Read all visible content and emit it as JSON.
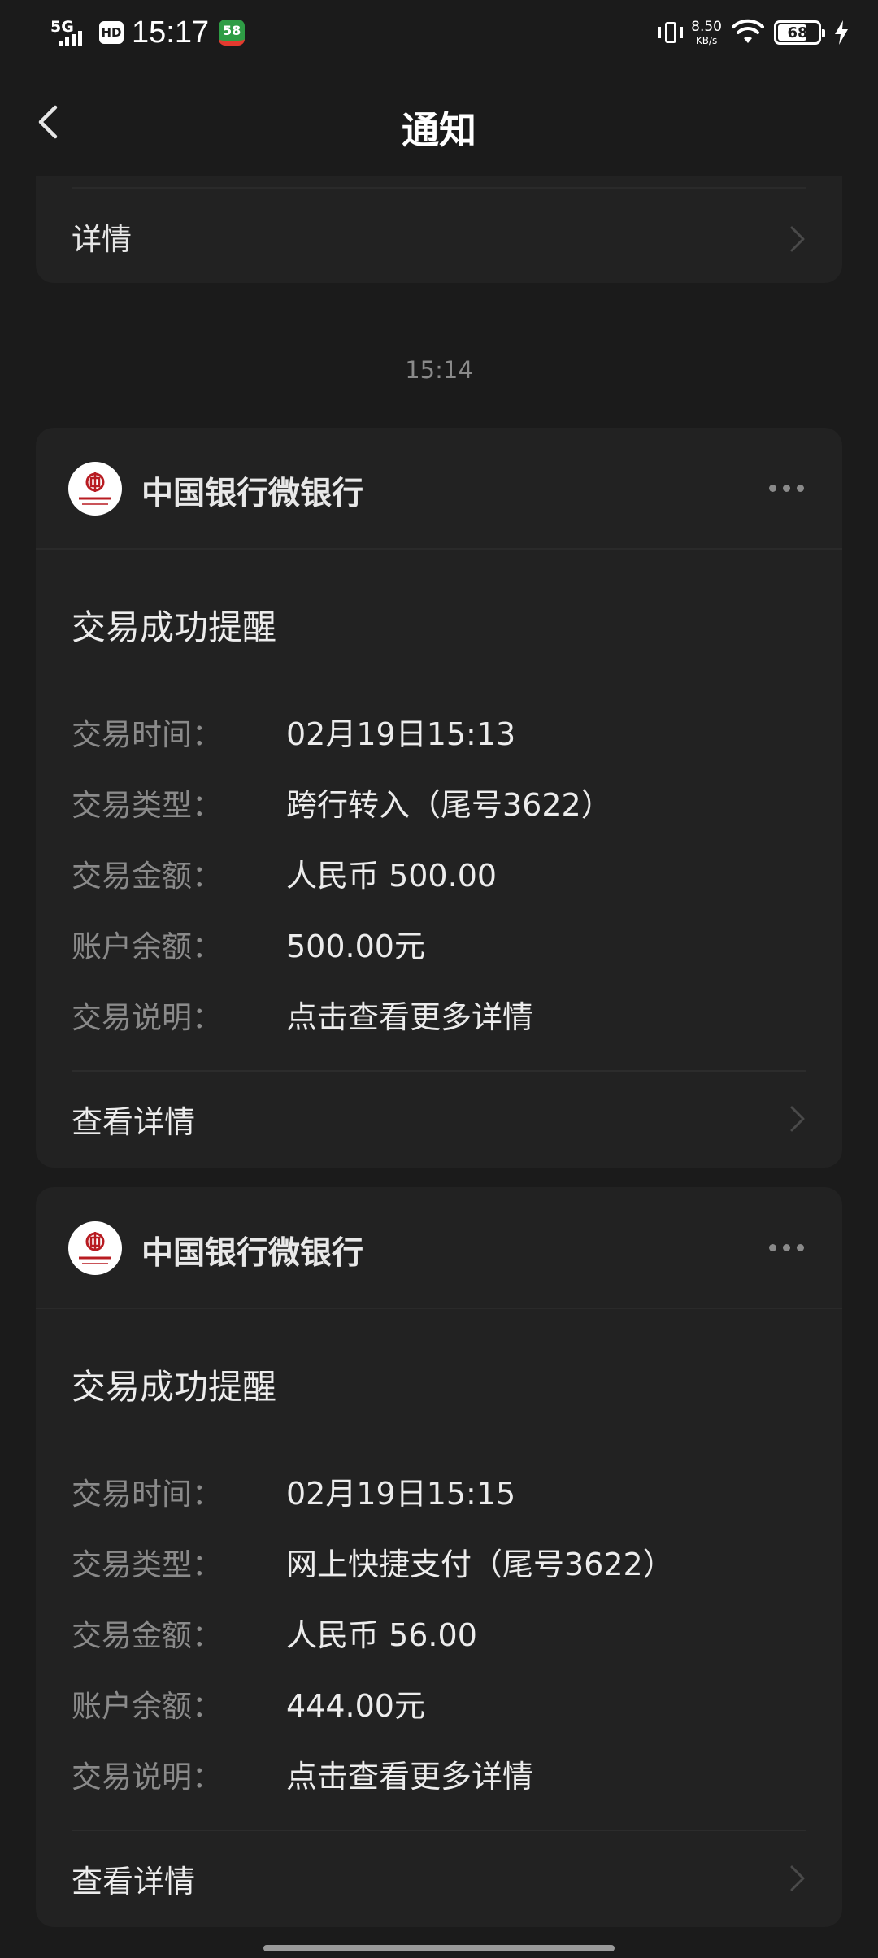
{
  "status_bar": {
    "network": "5G",
    "hd": "HD",
    "time": "15:17",
    "app_badge": "58",
    "net_speed_value": "8.50",
    "net_speed_unit": "KB/s",
    "battery_level": "68"
  },
  "header": {
    "title": "通知"
  },
  "prev_card": {
    "detail_label": "详情"
  },
  "timestamp": "15:14",
  "messages": [
    {
      "sender": "中国银行微银行",
      "title": "交易成功提醒",
      "fields": [
        {
          "label": "交易时间：",
          "value": "02月19日15:13"
        },
        {
          "label": "交易类型：",
          "value": "跨行转入（尾号3622）"
        },
        {
          "label": "交易金额：",
          "value": "人民币 500.00"
        },
        {
          "label": "账户余额：",
          "value": "500.00元"
        },
        {
          "label": "交易说明：",
          "value": "点击查看更多详情"
        }
      ],
      "footer_label": "查看详情"
    },
    {
      "sender": "中国银行微银行",
      "title": "交易成功提醒",
      "fields": [
        {
          "label": "交易时间：",
          "value": "02月19日15:15"
        },
        {
          "label": "交易类型：",
          "value": "网上快捷支付（尾号3622）"
        },
        {
          "label": "交易金额：",
          "value": "人民币 56.00"
        },
        {
          "label": "账户余额：",
          "value": "444.00元"
        },
        {
          "label": "交易说明：",
          "value": "点击查看更多详情"
        }
      ],
      "footer_label": "查看详情"
    }
  ],
  "icons": {
    "back": "chevron-left-icon",
    "chevron": "chevron-right-icon",
    "more": "more-dots-icon",
    "logo": "bank-of-china-logo",
    "wifi": "wifi-icon",
    "vibrate": "vibrate-icon",
    "charging": "charging-bolt-icon"
  },
  "colors": {
    "background": "#1b1b1b",
    "card": "#222222",
    "muted_text": "#8a8a8a",
    "boc_red": "#b81c22"
  }
}
